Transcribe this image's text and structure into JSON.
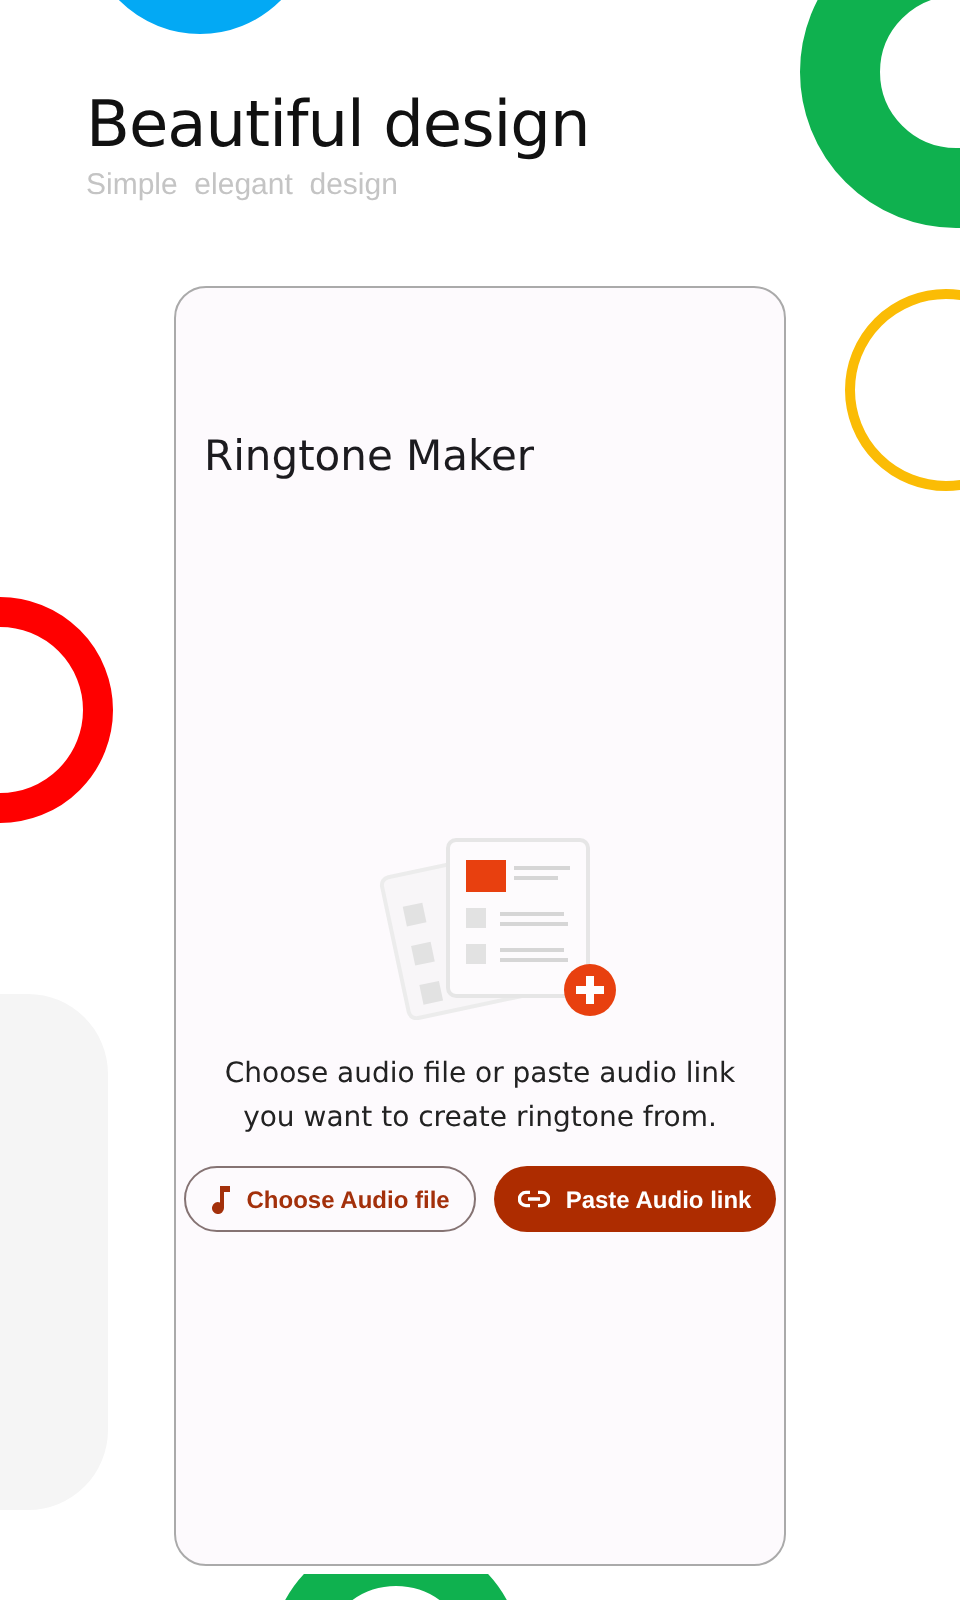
{
  "header": {
    "title": "Beautiful design",
    "subtitle": "Simple  elegant  design"
  },
  "app": {
    "title": "Ringtone Maker",
    "message": "Choose audio file or paste audio link you want to create ringtone from.",
    "buttons": [
      {
        "kind": "outlined",
        "label": "Choose Audio file"
      },
      {
        "kind": "filled",
        "label": "Paste Audio link"
      }
    ]
  }
}
